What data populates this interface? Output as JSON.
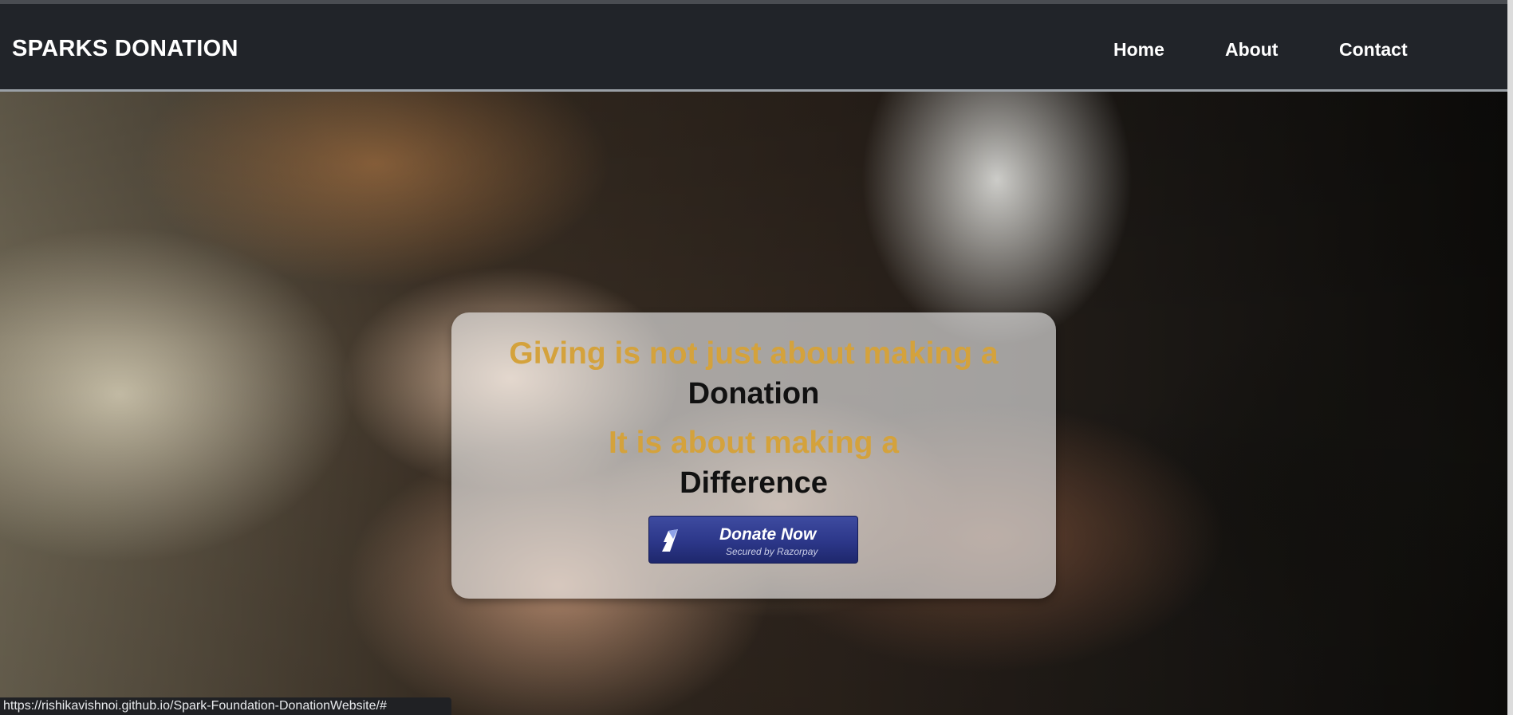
{
  "navbar": {
    "brand": "SPARKS DONATION",
    "links": [
      {
        "label": "Home"
      },
      {
        "label": "About"
      },
      {
        "label": "Contact"
      }
    ]
  },
  "hero": {
    "line1": "Giving is not just about making a",
    "line2": "Donation",
    "line3": "It is about making a",
    "line4": "Difference",
    "donate_button": {
      "label": "Donate Now",
      "sublabel": "Secured by Razorpay",
      "icon": "razorpay-logo-icon"
    }
  },
  "colors": {
    "navbar_bg": "#212429",
    "accent_gold": "#d4a23c",
    "button_blue": "#2c3789"
  },
  "status_bar": {
    "url": "https://rishikavishnoi.github.io/Spark-Foundation-DonationWebsite/#"
  }
}
